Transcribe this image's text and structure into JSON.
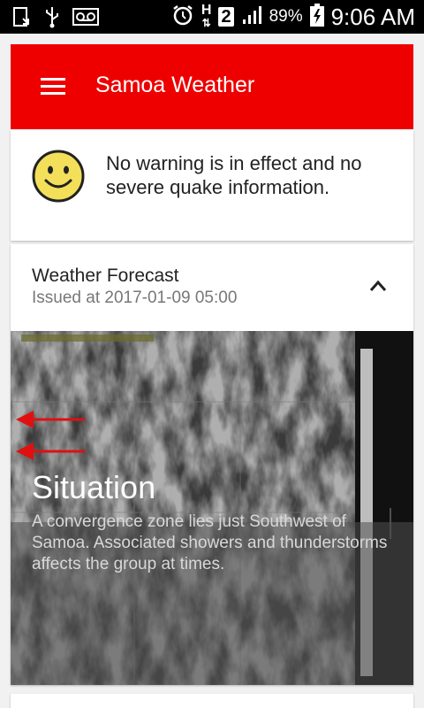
{
  "status_bar": {
    "battery_percent": "89%",
    "time": "9:06 AM",
    "sim_slot": "2",
    "network_type": "H",
    "icons": [
      "screenshot-icon",
      "usb-icon",
      "voicemail-icon",
      "alarm-icon",
      "network-h-icon",
      "sim-2-icon",
      "signal-icon",
      "battery-charging-icon"
    ]
  },
  "app_bar": {
    "title": "Samoa Weather",
    "menu_icon": "hamburger-menu-icon",
    "color": "#ee0000"
  },
  "warning": {
    "icon": "smiley-face-icon",
    "text": "No warning is in effect and no severe quake information."
  },
  "forecast": {
    "title": "Weather Forecast",
    "issued": "Issued at 2017-01-09 05:00",
    "toggle_icon": "chevron-up-icon",
    "situation_title": "Situation",
    "situation_text": "A convergence zone lies just Southwest of Samoa. Associated showers and thunderstorms affects the group at times."
  }
}
